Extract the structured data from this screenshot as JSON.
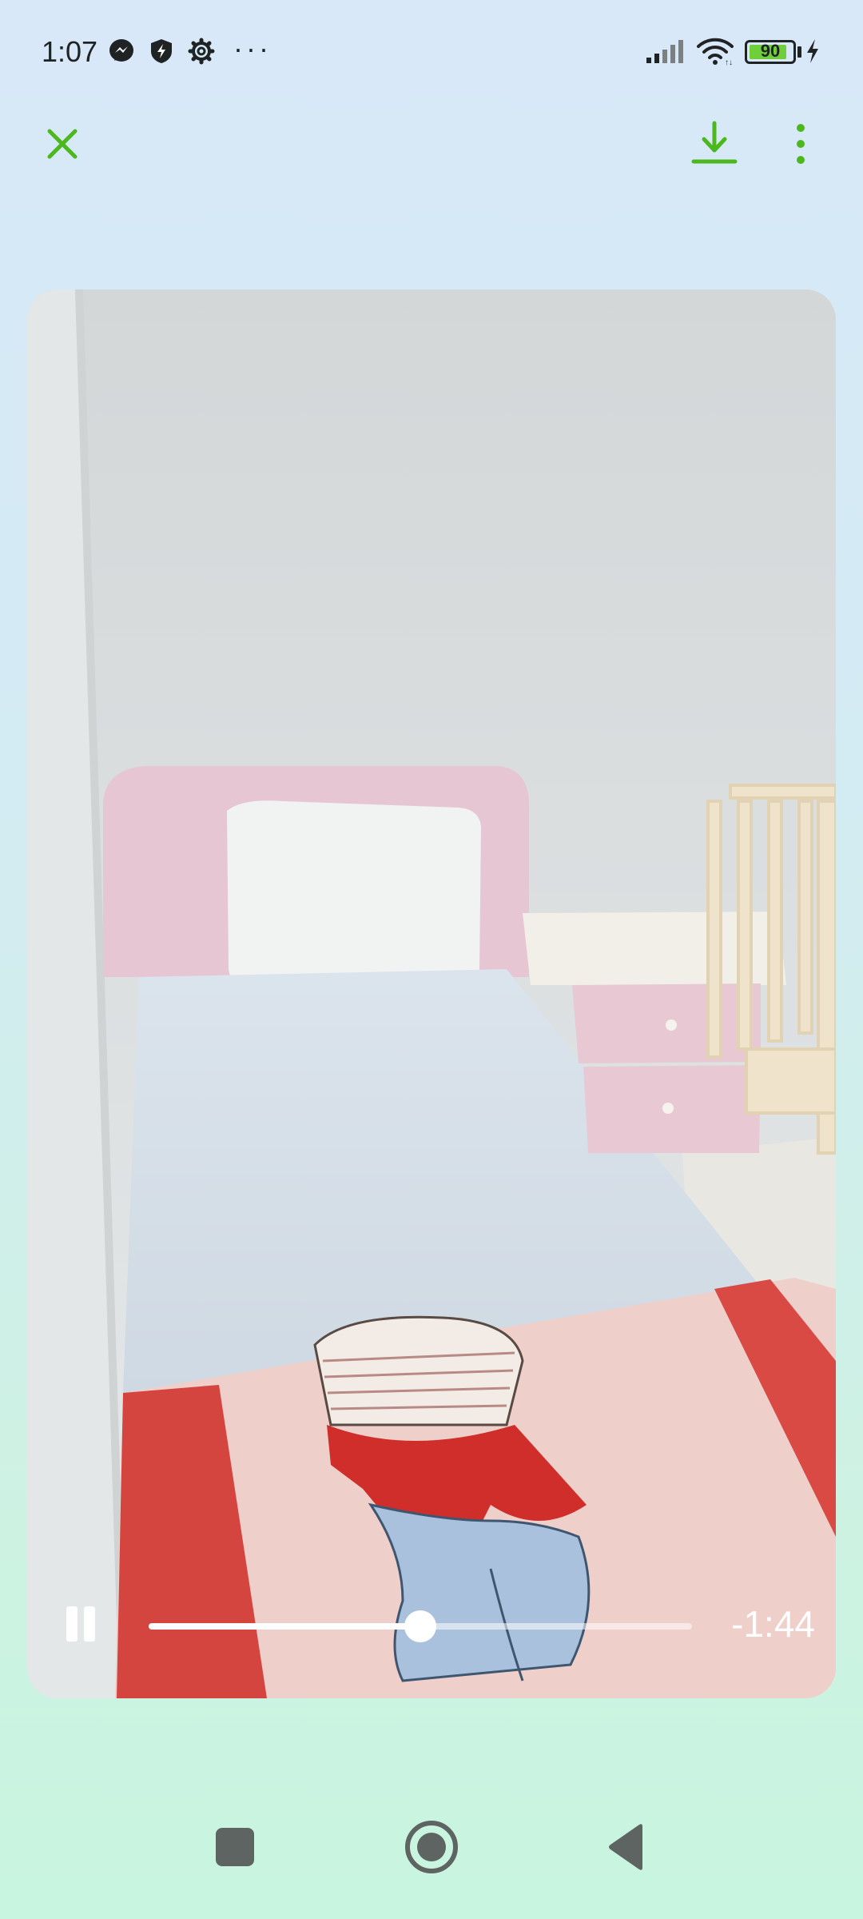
{
  "status_bar": {
    "time": "1:07",
    "battery_level": "90",
    "battery_fraction": 0.9,
    "icons": [
      "messenger-icon",
      "shield-bolt-icon",
      "gear-icon",
      "more-dots-icon",
      "signal-icon",
      "wifi-icon",
      "battery-icon",
      "charging-bolt-icon"
    ]
  },
  "top_bar": {
    "close_icon": "close-icon",
    "download_icon": "download-icon",
    "menu_icon": "more-vertical-icon",
    "accent_color": "#4cb81e"
  },
  "video": {
    "remaining_time": "-1:44",
    "progress_fraction": 0.5,
    "state": "playing"
  },
  "nav_bar": {
    "icons": [
      "recents-square-icon",
      "home-circle-icon",
      "back-triangle-icon"
    ]
  }
}
